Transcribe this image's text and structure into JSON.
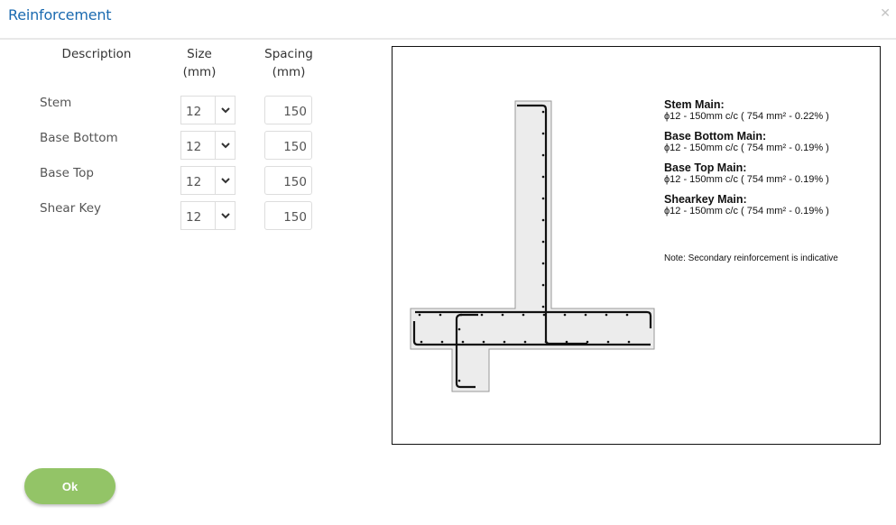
{
  "dialog": {
    "title": "Reinforcement",
    "close_icon": "close-icon"
  },
  "table": {
    "headers": {
      "description": "Description",
      "size_line1": "Size",
      "size_line2": "(mm)",
      "spacing_line1": "Spacing",
      "spacing_line2": "(mm)"
    },
    "rows": [
      {
        "label": "Stem",
        "size": "12",
        "spacing": "150"
      },
      {
        "label": "Base Bottom",
        "size": "12",
        "spacing": "150"
      },
      {
        "label": "Base Top",
        "size": "12",
        "spacing": "150"
      },
      {
        "label": "Shear Key",
        "size": "12",
        "spacing": "150"
      }
    ]
  },
  "drawing": {
    "notes": [
      {
        "title": "Stem Main:",
        "detail": "ϕ12 - 150mm c/c ( 754 mm² - 0.22% )"
      },
      {
        "title": "Base Bottom Main:",
        "detail": "ϕ12 - 150mm c/c ( 754 mm² - 0.19% )"
      },
      {
        "title": "Base Top Main:",
        "detail": "ϕ12 - 150mm c/c ( 754 mm² - 0.19% )"
      },
      {
        "title": "Shearkey Main:",
        "detail": "ϕ12 - 150mm c/c ( 754 mm² - 0.19% )"
      }
    ],
    "footnote": "Note: Secondary reinforcement is indicative",
    "colors": {
      "concrete": "#ececec",
      "outline": "#999999",
      "rebar": "#111111"
    }
  },
  "footer": {
    "ok_label": "Ok",
    "ok_color": "#93c467"
  }
}
